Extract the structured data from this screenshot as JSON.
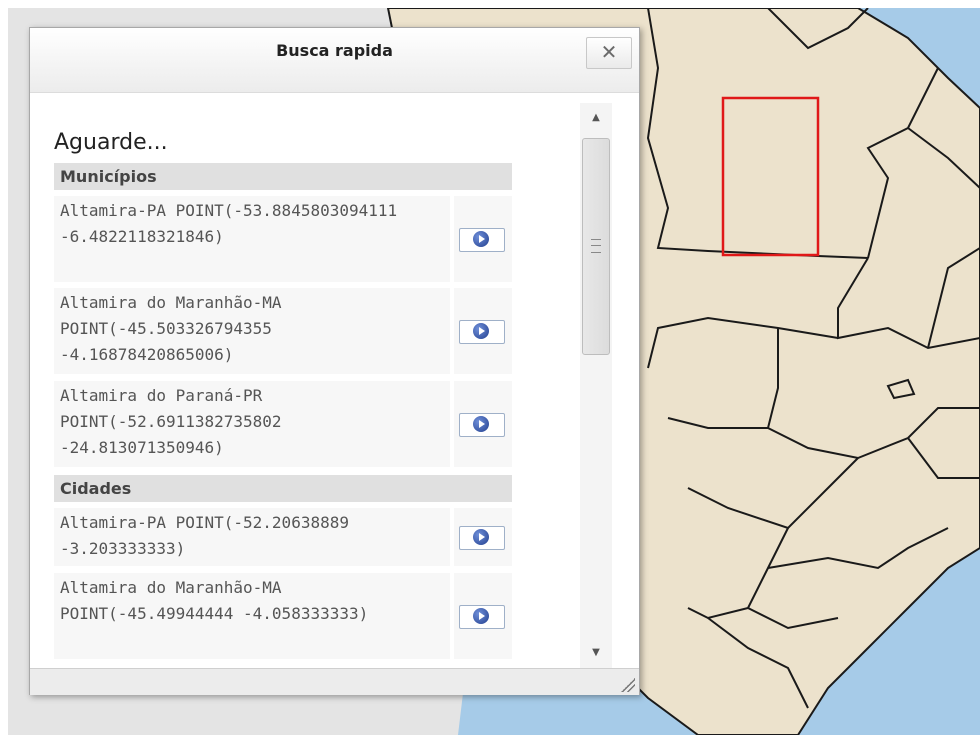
{
  "dialog": {
    "title": "Busca rapida",
    "close_label": "✕",
    "status": "Aguarde..."
  },
  "sections": [
    {
      "header": "Municípios",
      "results": [
        {
          "text": "Altamira-PA POINT(-53.8845803094111 -6.4822118321846)"
        },
        {
          "text": "Altamira do Maranhão-MA POINT(-45.503326794355 -4.16878420865006)"
        },
        {
          "text": "Altamira do Paraná-PR POINT(-52.6911382735802 -24.813071350946)"
        }
      ]
    },
    {
      "header": "Cidades",
      "results": [
        {
          "text": "Altamira-PA POINT(-52.20638889 -3.203333333)"
        },
        {
          "text": "Altamira do Maranhão-MA POINT(-45.49944444 -4.058333333)"
        }
      ]
    }
  ],
  "icons": {
    "go": "circle-arrow-right-icon",
    "close": "close-icon",
    "scroll_up": "scroll-up-arrow-icon",
    "scroll_down": "scroll-down-arrow-icon",
    "resize": "resize-grip-icon"
  },
  "colors": {
    "map_land": "#ece2cc",
    "map_ocean": "#a6cbe8",
    "map_foreign": "#e4e4e4",
    "map_border": "#1a1a1a",
    "selection_box": "#e01818"
  }
}
